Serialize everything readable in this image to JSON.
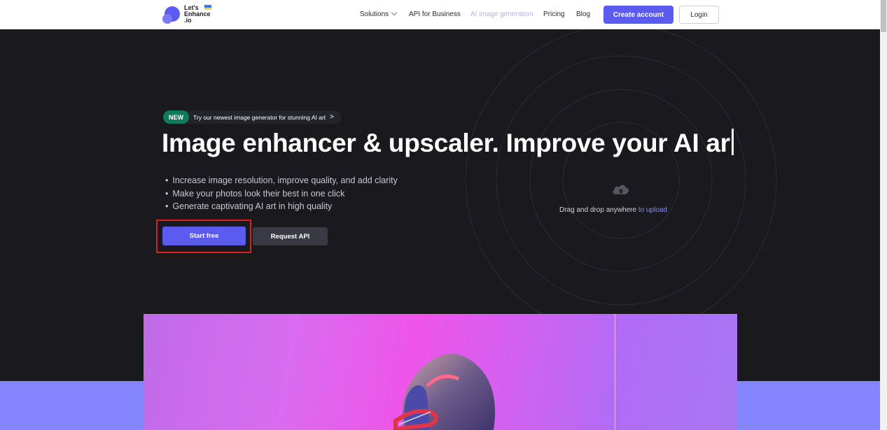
{
  "header": {
    "logo_text": "Let's\nEnhance\n.io",
    "nav": {
      "solutions": "Solutions",
      "api_business": "API for Business",
      "ai_image": "AI image generation",
      "pricing": "Pricing",
      "blog": "Blog"
    },
    "create_account": "Create account",
    "login": "Login"
  },
  "hero": {
    "badge_new": "NEW",
    "badge_text": "Try our newest image generator for stunning AI art",
    "badge_arrow": ">",
    "title": "Image enhancer & upscaler.  Improve your AI ar",
    "bullets": [
      "Increase image resolution, improve quality, and add clarity",
      "Make your photos look their best in one click",
      "Generate captivating AI art in high quality"
    ],
    "start_free": "Start free",
    "request_api": "Request API"
  },
  "upload": {
    "text": "Drag and drop anywhere ",
    "link": "to upload"
  },
  "colors": {
    "accent": "#5b5bf0",
    "background": "#19191e",
    "new_badge": "#117a5b",
    "highlight_box": "#d81f1f",
    "lavender": "#8585ff"
  },
  "icons": {
    "upload": "cloud-upload-icon",
    "chevron": "chevron-down-icon",
    "badge_arrow": "chevron-right-icon"
  }
}
